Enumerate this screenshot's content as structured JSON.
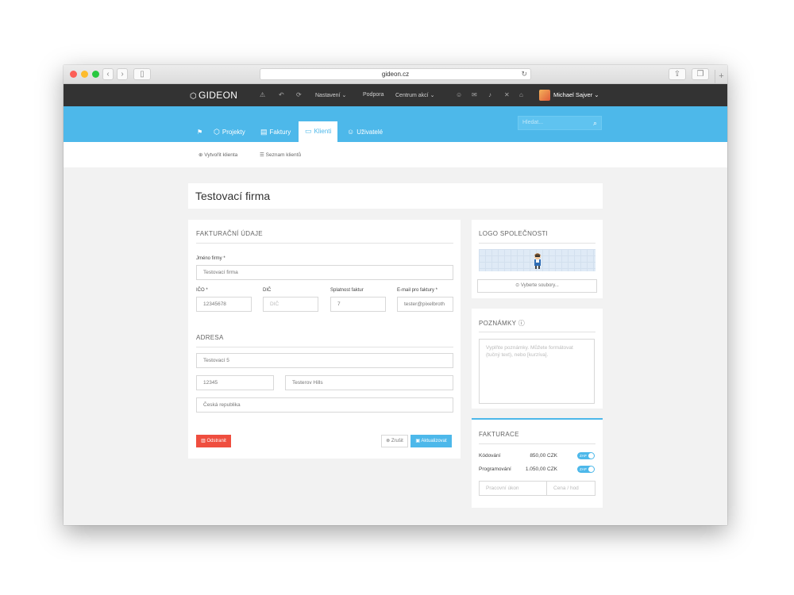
{
  "browser": {
    "url": "gideon.cz"
  },
  "topbar": {
    "brand": "GIDEON",
    "links": [
      "Nastavení",
      "Podpora",
      "Centrum akcí"
    ],
    "user_name": "Michael Sajver"
  },
  "nav": {
    "items": [
      {
        "label": "Projekty",
        "icon": "box-icon"
      },
      {
        "label": "Faktury",
        "icon": "invoice-icon"
      },
      {
        "label": "Klienti",
        "icon": "card-icon",
        "active": true
      },
      {
        "label": "Uživatelé",
        "icon": "users-icon"
      }
    ],
    "search_placeholder": "Hledat..."
  },
  "subnav": {
    "create": "Vytvořit klienta",
    "list": "Seznam klientů"
  },
  "page": {
    "title": "Testovací firma"
  },
  "billing": {
    "section_title": "FAKTURAČNÍ ÚDAJE",
    "company_label": "Jméno firmy *",
    "company_value": "Testovací firma",
    "ico_label": "IČO *",
    "ico_value": "12345678",
    "dic_label": "DIČ",
    "dic_placeholder": "DIČ",
    "due_label": "Splatnost faktur",
    "due_value": "7",
    "email_label": "E-mail pro faktury *",
    "email_value": "tester@pixelbroth"
  },
  "address": {
    "section_title": "ADRESA",
    "street": "Testovací 5",
    "zip": "12345",
    "city": "Testerov Hills",
    "country": "Česká republika"
  },
  "actions": {
    "delete": "Odstranit",
    "cancel": "Zrušit",
    "update": "Aktualizovat"
  },
  "logo_panel": {
    "title": "LOGO SPOLEČNOSTI",
    "choose_files": "Vyberte soubory..."
  },
  "notes_panel": {
    "title": "POZNÁMKY",
    "placeholder": "Vyplňte poznámky. Můžete formátovat (tučný text), nebo [kurzíva]."
  },
  "invoicing_panel": {
    "title": "FAKTURACE",
    "rows": [
      {
        "label": "Kódování",
        "value": "850,00 CZK",
        "toggle": "ZAP"
      },
      {
        "label": "Programování",
        "value": "1.050,00 CZK",
        "toggle": "ZAP"
      }
    ],
    "work_placeholder": "Pracovní úkon",
    "price_placeholder": "Cena / hod"
  },
  "colors": {
    "accent": "#4db8ea",
    "topbar": "#333333",
    "danger": "#ef4e3f"
  }
}
